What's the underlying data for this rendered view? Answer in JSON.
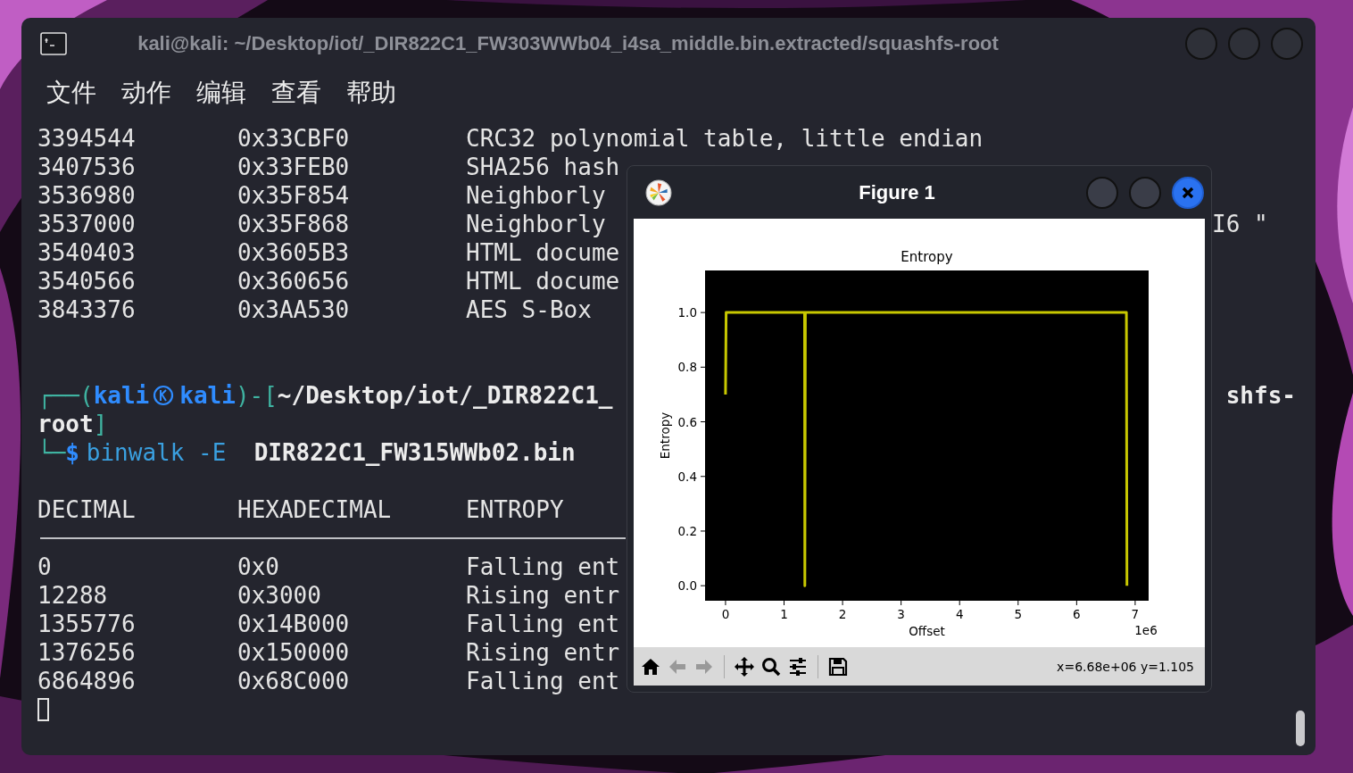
{
  "terminal": {
    "title": "kali@kali: ~/Desktop/iot/_DIR822C1_FW303WWb04_i4sa_middle.bin.extracted/squashfs-root",
    "menu": [
      "文件",
      "动作",
      "编辑",
      "查看",
      "帮助"
    ],
    "signature_rows": [
      {
        "decimal": "3394544",
        "hex": "0x33CBF0",
        "description": "CRC32 polynomial table, little endian"
      },
      {
        "decimal": "3407536",
        "hex": "0x33FEB0",
        "description": "SHA256 hash"
      },
      {
        "decimal": "3536980",
        "hex": "0x35F854",
        "description": "Neighborly"
      },
      {
        "decimal": "3537000",
        "hex": "0x35F868",
        "description": "Neighborly",
        "tail": "I6 \""
      },
      {
        "decimal": "3540403",
        "hex": "0x3605B3",
        "description": "HTML docume"
      },
      {
        "decimal": "3540566",
        "hex": "0x360656",
        "description": "HTML docume"
      },
      {
        "decimal": "3843376",
        "hex": "0x3AA530",
        "description": "AES S-Box"
      }
    ],
    "prompt": [
      {
        "segments": [
          {
            "kind": "frame",
            "text": "┌──("
          },
          {
            "kind": "user",
            "text": "kali"
          },
          {
            "kind": "logo"
          },
          {
            "kind": "user",
            "text": "kali"
          },
          {
            "kind": "frame",
            "text": ")-["
          },
          {
            "kind": "path",
            "text": "~/Desktop/iot/_DIR822C1_"
          }
        ],
        "tail": "shfs-"
      },
      {
        "segments": [
          {
            "kind": "path",
            "text": "root"
          },
          {
            "kind": "frame",
            "text": "]"
          }
        ]
      },
      {
        "segments": [
          {
            "kind": "frame",
            "text": "└─"
          },
          {
            "kind": "symbol",
            "text": "$"
          },
          {
            "kind": "command",
            "text": "binwalk -E"
          },
          {
            "kind": "argument",
            "text": "DIR822C1_FW315WWb02.bin"
          }
        ]
      }
    ],
    "entropy_columns": [
      "DECIMAL",
      "HEXADECIMAL",
      "ENTROPY"
    ],
    "entropy_rows": [
      {
        "decimal": "0",
        "hex": "0x0",
        "description": "Falling ent"
      },
      {
        "decimal": "12288",
        "hex": "0x3000",
        "description": "Rising entr"
      },
      {
        "decimal": "1355776",
        "hex": "0x14B000",
        "description": "Falling ent"
      },
      {
        "decimal": "1376256",
        "hex": "0x150000",
        "description": "Rising entr"
      },
      {
        "decimal": "6864896",
        "hex": "0x68C000",
        "description": "Falling ent"
      }
    ]
  },
  "figure": {
    "title": "Figure 1",
    "chart_data": {
      "type": "line",
      "title": "Entropy",
      "xlabel": "Offset",
      "ylabel": "Entropy",
      "x": [
        0,
        0.01,
        1.35,
        1.355,
        1.365,
        6.85,
        6.86
      ],
      "series": [
        {
          "color": "#c8c800",
          "values": [
            0.7,
            1.0,
            1.0,
            0.0,
            1.0,
            1.0,
            0.0
          ]
        }
      ],
      "xlim": [
        -0.35,
        7.23
      ],
      "ylim": [
        -0.055,
        1.154
      ],
      "xticks": [
        0,
        1,
        2,
        3,
        4,
        5,
        6,
        7
      ],
      "yticks": [
        {
          "value": 0,
          "label": "0.0"
        },
        {
          "value": 0.2,
          "label": "0.2"
        },
        {
          "value": 0.4,
          "label": "0.4"
        },
        {
          "value": 0.6,
          "label": "0.6"
        },
        {
          "value": 0.8,
          "label": "0.8"
        },
        {
          "value": 1,
          "label": "1.0"
        }
      ],
      "annotations": [
        {
          "text": "1e6"
        }
      ]
    },
    "tools": [
      {
        "kind": "home",
        "disabled": false
      },
      {
        "kind": "back",
        "disabled": true
      },
      {
        "kind": "forward",
        "disabled": true
      },
      {
        "kind": "separator"
      },
      {
        "kind": "pan",
        "disabled": false
      },
      {
        "kind": "zoom",
        "disabled": false
      },
      {
        "kind": "configure",
        "disabled": false
      },
      {
        "kind": "separator"
      },
      {
        "kind": "save",
        "disabled": false
      }
    ],
    "coordinates": "x=6.68e+06 y=1.105"
  }
}
